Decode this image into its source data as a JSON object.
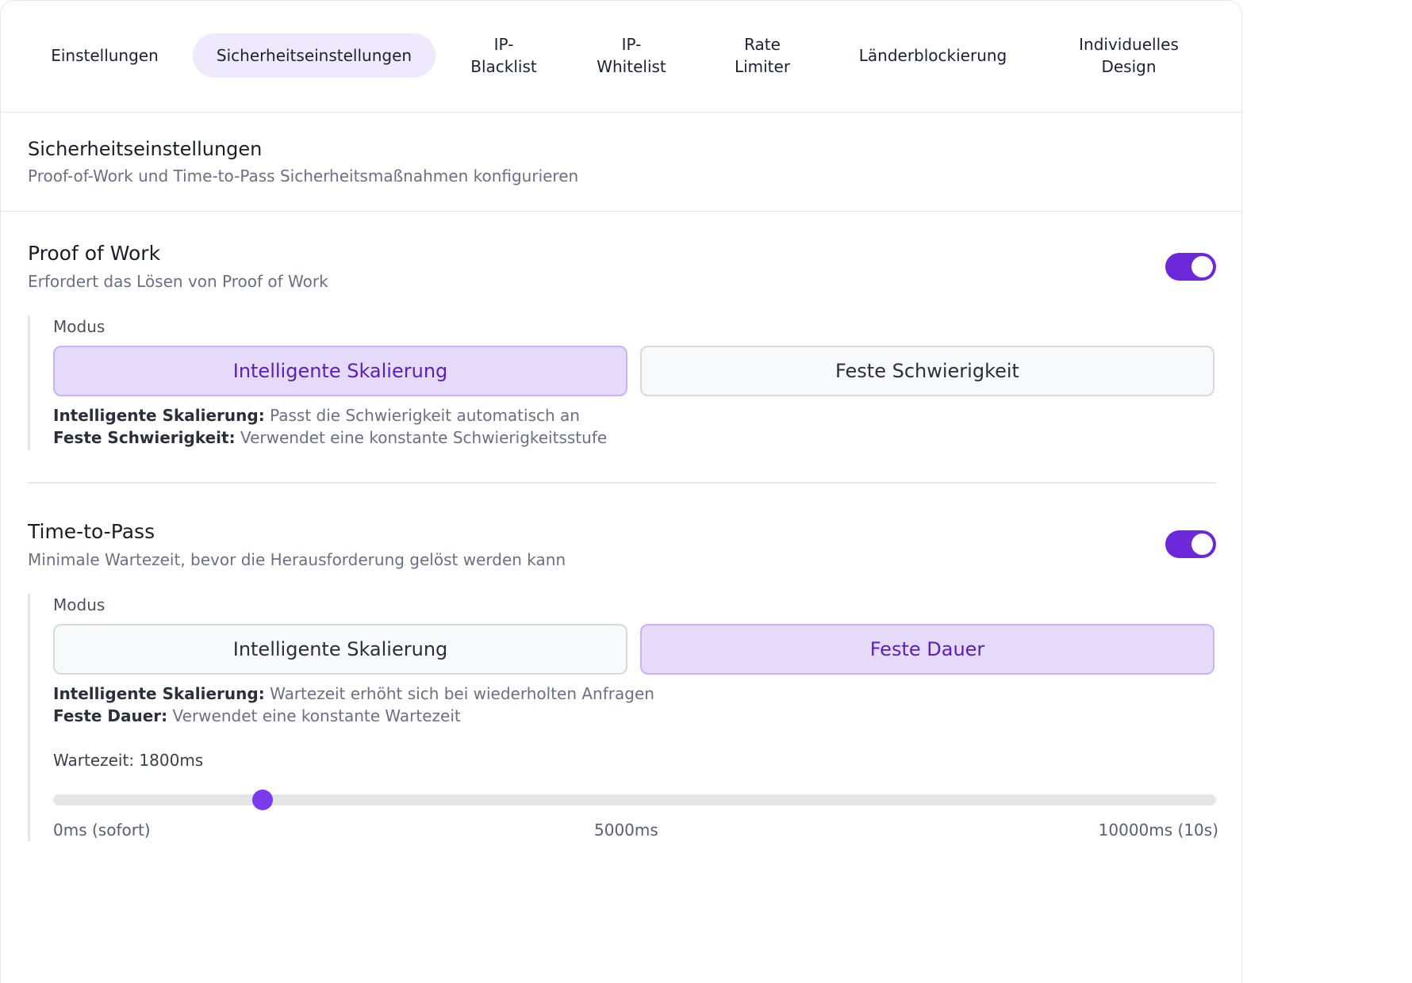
{
  "tabs": [
    {
      "label": "Einstellungen",
      "active": false
    },
    {
      "label": "Sicherheitseinstellungen",
      "active": true
    },
    {
      "label": "IP-\nBlacklist",
      "active": false
    },
    {
      "label": "IP-\nWhitelist",
      "active": false
    },
    {
      "label": "Rate\nLimiter",
      "active": false
    },
    {
      "label": "Länderblockierung",
      "active": false
    },
    {
      "label": "Individuelles\nDesign",
      "active": false
    }
  ],
  "header": {
    "title": "Sicherheitseinstellungen",
    "subtitle": "Proof-of-Work und Time-to-Pass Sicherheitsmaßnahmen konfigurieren"
  },
  "pow": {
    "title": "Proof of Work",
    "subtitle": "Erfordert das Lösen von Proof of Work",
    "enabled": true,
    "modus_label": "Modus",
    "options": [
      "Intelligente Skalierung",
      "Feste Schwierigkeit"
    ],
    "selected": "Intelligente Skalierung",
    "desc1_term": "Intelligente Skalierung:",
    "desc1_text": " Passt die Schwierigkeit automatisch an",
    "desc2_term": "Feste Schwierigkeit:",
    "desc2_text": " Verwendet eine konstante Schwierigkeitsstufe"
  },
  "ttp": {
    "title": "Time-to-Pass",
    "subtitle": "Minimale Wartezeit, bevor die Herausforderung gelöst werden kann",
    "enabled": true,
    "modus_label": "Modus",
    "options": [
      "Intelligente Skalierung",
      "Feste Dauer"
    ],
    "selected": "Feste Dauer",
    "desc1_term": "Intelligente Skalierung:",
    "desc1_text": " Wartezeit erhöht sich bei wiederholten Anfragen",
    "desc2_term": "Feste Dauer:",
    "desc2_text": " Verwendet eine konstante Wartezeit",
    "wait_label": "Wartezeit: 1800ms",
    "slider": {
      "min": 0,
      "max": 10000,
      "value": 1800
    },
    "ticks": {
      "min": "0ms (sofort)",
      "mid": "5000ms",
      "max": "10000ms (10s)"
    }
  },
  "colors": {
    "accent": "#6d28d9",
    "active_bg": "#e5dafa",
    "active_text": "#5b21b6"
  }
}
